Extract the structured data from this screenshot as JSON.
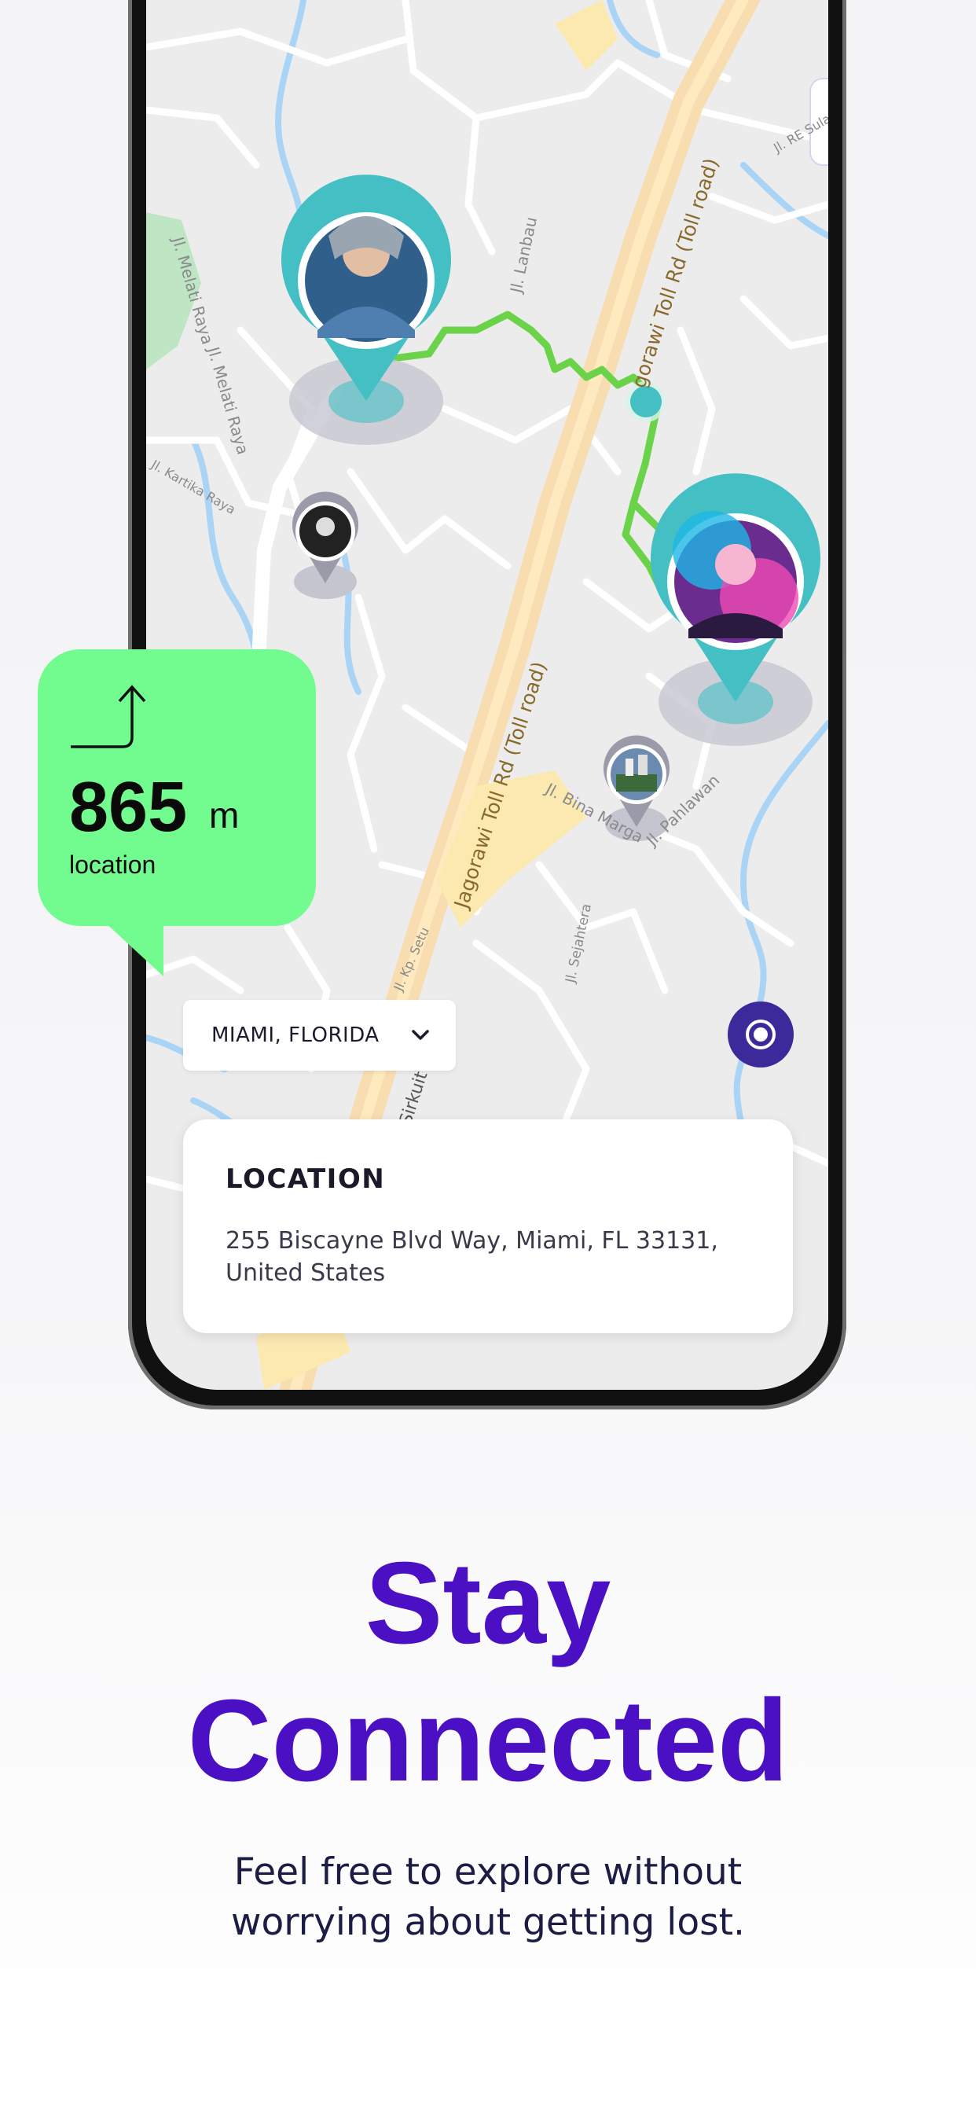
{
  "distance_card": {
    "value": "865",
    "unit": "m",
    "caption": "location",
    "icon": "turn-right-arrow-icon",
    "color": "#72fb8e"
  },
  "city_selector": {
    "selected": "MIAMI, FLORIDA",
    "icon": "chevron-down-icon"
  },
  "locate_button": {
    "icon": "target-icon",
    "color": "#3d2a9a"
  },
  "location_card": {
    "title": "LOCATION",
    "address": "255 Biscayne Blvd Way, Miami,  FL 33131, United States"
  },
  "map": {
    "route_color": "#6bd34a",
    "pin_color": "#44c0c4",
    "road_labels": [
      "gorawi Toll Rd (Toll road)",
      "Jagorawi Toll Rd (Toll road)",
      "Sirkuit Sentul"
    ],
    "street_labels": [
      "Jl. Melati Raya",
      "Jl. Melati Raya",
      "Jl. Lanbau",
      "Jl. Kartika Raya",
      "Jl. Bina Marga",
      "Jl. Pahlawan",
      "Jl. Sejahtera",
      "Jl. Kp. Setu",
      "Jl. RE Sulaeman"
    ]
  },
  "headline": {
    "line1": "Stay",
    "line2": "Connected",
    "color": "#4b0fc4"
  },
  "tagline": {
    "line1": "Feel free to explore without",
    "line2": "worrying about getting lost."
  }
}
